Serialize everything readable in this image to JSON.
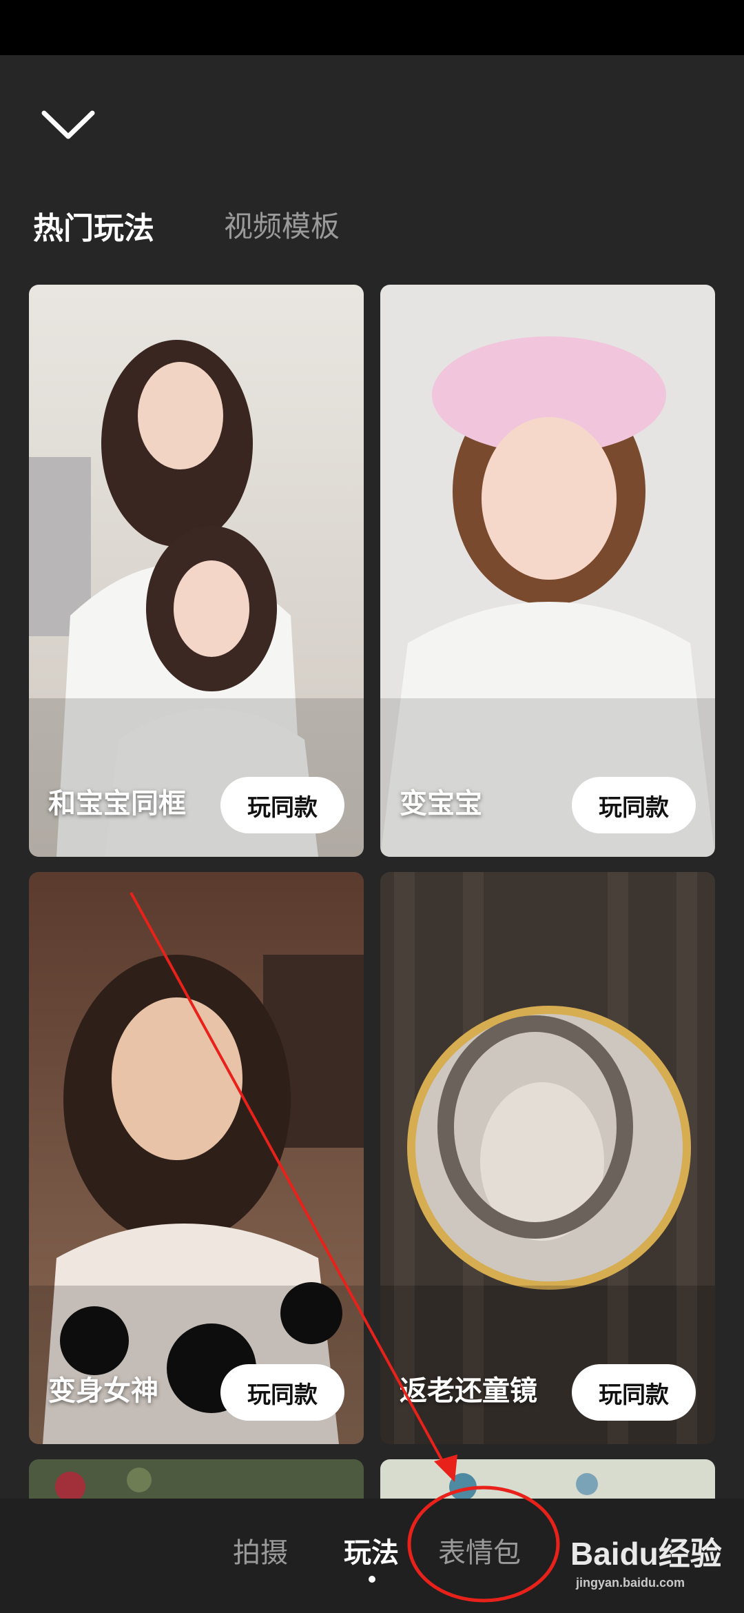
{
  "header": {
    "tabs": [
      {
        "label": "热门玩法",
        "active": true
      },
      {
        "label": "视频模板",
        "active": false
      }
    ]
  },
  "cards": [
    {
      "title": "和宝宝同框",
      "button": "玩同款"
    },
    {
      "title": "变宝宝",
      "button": "玩同款"
    },
    {
      "title": "变身女神",
      "button": "玩同款"
    },
    {
      "title": "返老还童镜",
      "button": "玩同款"
    }
  ],
  "bottom_nav": {
    "items": [
      {
        "label": "拍摄",
        "active": false
      },
      {
        "label": "玩法",
        "active": true
      },
      {
        "label": "表情包",
        "active": false
      }
    ]
  },
  "watermark": {
    "text": "Baidu经验",
    "sub": "jingyan.baidu.com"
  },
  "icons": {
    "collapse": "chevron-down-icon"
  },
  "colors": {
    "annotation": "#e8221a",
    "background": "#262626"
  }
}
